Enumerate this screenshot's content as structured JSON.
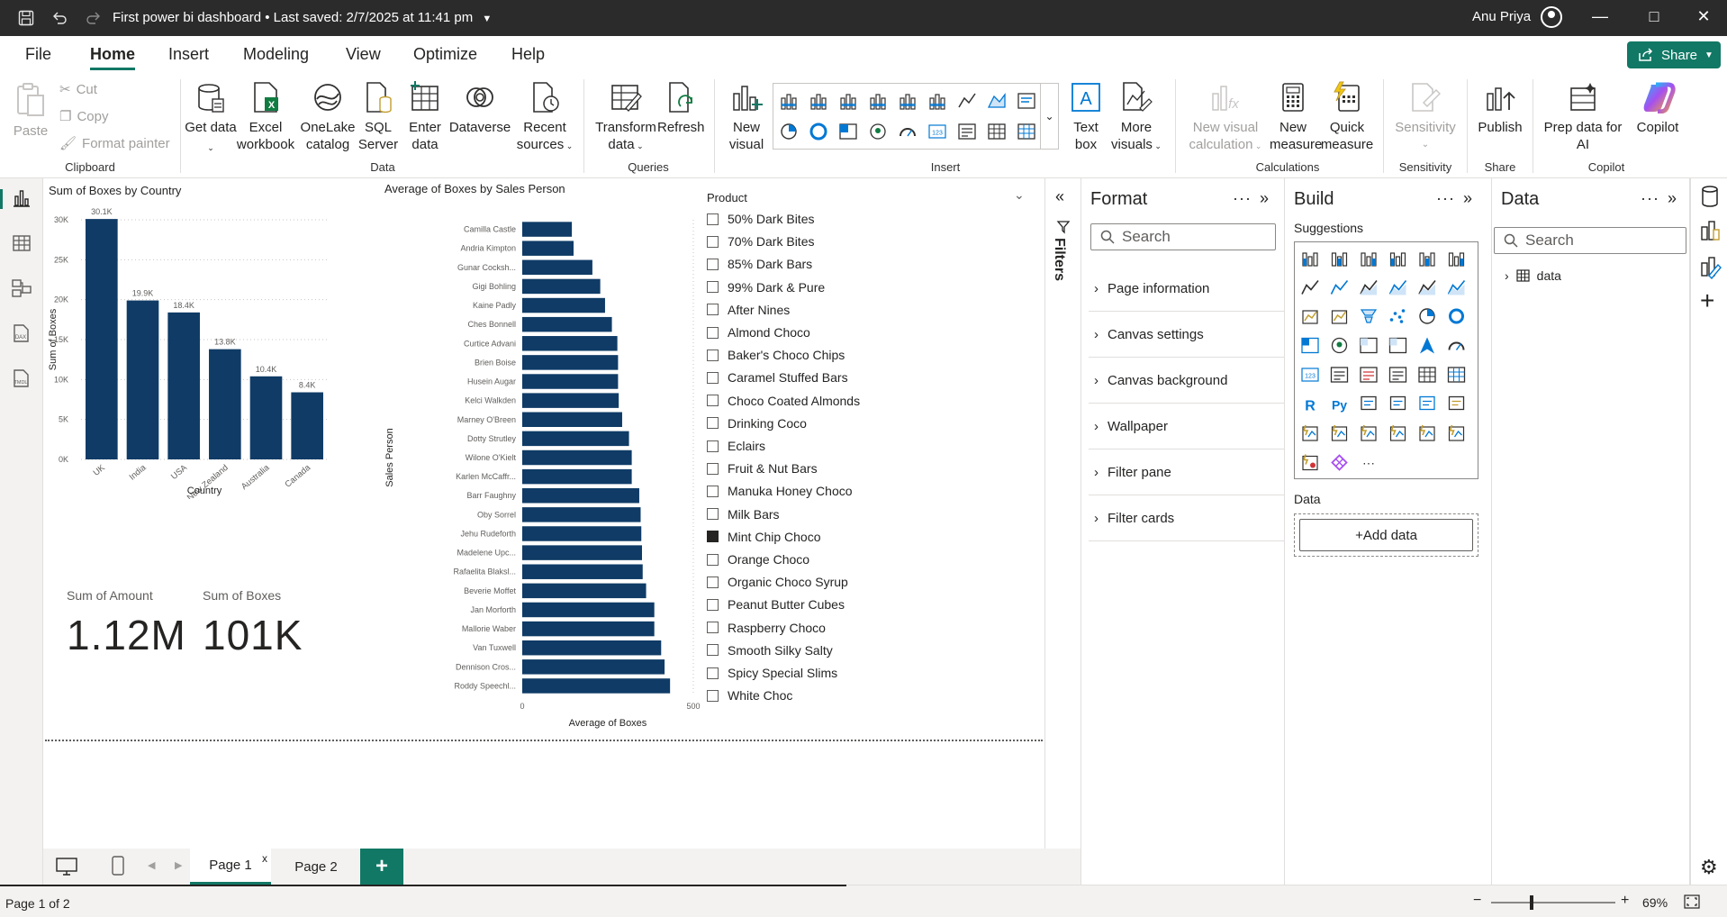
{
  "titlebar": {
    "title": "First power bi dashboard • Last saved: 2/7/2025 at 11:41 pm",
    "user": "Anu Priya",
    "minimize": "—",
    "maximize": "□",
    "close": "✕"
  },
  "menu": {
    "tabs": [
      "File",
      "Home",
      "Insert",
      "Modeling",
      "View",
      "Optimize",
      "Help"
    ],
    "active": "Home",
    "share": "Share"
  },
  "ribbon": {
    "paste": "Paste",
    "cut": "Cut",
    "copy": "Copy",
    "format_painter": "Format painter",
    "get_data": "Get data",
    "excel_workbook": "Excel workbook",
    "onelake_catalog": "OneLake catalog",
    "sql_server": "SQL Server",
    "enter_data": "Enter data",
    "dataverse": "Dataverse",
    "recent_sources": "Recent sources",
    "transform_data": "Transform data",
    "refresh": "Refresh",
    "new_visual": "New visual",
    "text_box": "Text box",
    "more_visuals": "More visuals",
    "new_visual_calculation": "New visual calculation",
    "new_measure": "New measure",
    "quick_measure": "Quick measure",
    "sensitivity": "Sensitivity",
    "publish": "Publish",
    "prep_data_copilot": "Prep data for AI",
    "copilot": "Copilot",
    "groups": {
      "clipboard": "Clipboard",
      "data": "Data",
      "queries": "Queries",
      "insert": "Insert",
      "calculations": "Calculations",
      "sensitivity": "Sensitivity",
      "share": "Share",
      "copilot": "Copilot"
    }
  },
  "leftnav": [
    "report-view",
    "table-view",
    "model-view",
    "dax-query-view",
    "tmdl-view"
  ],
  "visuals": {
    "bar_country": {
      "title": "Sum of Boxes by Country",
      "xlabel": "Country",
      "ylabel": "Sum of Boxes"
    },
    "hbar_sales": {
      "title": "Average of Boxes by Sales Person",
      "xlabel": "Average of Boxes",
      "ylabel": "Sales Person"
    },
    "card_amount": {
      "label": "Sum of Amount",
      "value": "1.12M"
    },
    "card_boxes": {
      "label": "Sum of Boxes",
      "value": "101K"
    }
  },
  "chart_data": [
    {
      "type": "bar",
      "title": "Sum of Boxes by Country",
      "xlabel": "Country",
      "ylabel": "Sum of Boxes",
      "categories": [
        "UK",
        "India",
        "USA",
        "New Zealand",
        "Australia",
        "Canada"
      ],
      "values": [
        30100,
        19900,
        18400,
        13800,
        10400,
        8400
      ],
      "data_labels": [
        "30.1K",
        "19.9K",
        "18.4K",
        "13.8K",
        "10.4K",
        "8.4K"
      ],
      "yticks": [
        0,
        5000,
        10000,
        15000,
        20000,
        25000,
        30000
      ],
      "ytick_labels": [
        "0K",
        "5K",
        "10K",
        "15K",
        "20K",
        "25K",
        "30K"
      ],
      "ylim": [
        0,
        30000
      ],
      "color": "#0f3b66",
      "grid": true
    },
    {
      "type": "bar",
      "orientation": "horizontal",
      "title": "Average of Boxes by Sales Person",
      "xlabel": "Average of Boxes",
      "ylabel": "Sales Person",
      "categories": [
        "Camilla Castle",
        "Andria Kimpton",
        "Gunar Cocksh...",
        "Gigi Bohling",
        "Kaine Padly",
        "Ches Bonnell",
        "Curtice Advani",
        "Brien Boise",
        "Husein Augar",
        "Kelci Walkden",
        "Marney O'Breen",
        "Dotty Strutley",
        "Wilone O'Kielt",
        "Karlen McCaffr...",
        "Barr Faughny",
        "Oby Sorrel",
        "Jehu Rudeforth",
        "Madelene Upc...",
        "Rafaelita Blaksl...",
        "Beverie Moffet",
        "Jan Morforth",
        "Mallorie Waber",
        "Van Tuxwell",
        "Dennison Cros...",
        "Roddy Speechl..."
      ],
      "values": [
        145,
        150,
        205,
        228,
        242,
        262,
        278,
        280,
        280,
        282,
        292,
        312,
        320,
        320,
        342,
        346,
        348,
        350,
        352,
        362,
        386,
        386,
        406,
        416,
        432
      ],
      "xticks": [
        0,
        500
      ],
      "xlim": [
        0,
        500
      ],
      "color": "#0f3b66"
    }
  ],
  "slicer": {
    "title": "Product",
    "items": [
      {
        "label": "50% Dark Bites",
        "checked": false
      },
      {
        "label": "70% Dark Bites",
        "checked": false
      },
      {
        "label": "85% Dark Bars",
        "checked": false
      },
      {
        "label": "99% Dark & Pure",
        "checked": false
      },
      {
        "label": "After Nines",
        "checked": false
      },
      {
        "label": "Almond Choco",
        "checked": false
      },
      {
        "label": "Baker's Choco Chips",
        "checked": false
      },
      {
        "label": "Caramel Stuffed Bars",
        "checked": false
      },
      {
        "label": "Choco Coated Almonds",
        "checked": false
      },
      {
        "label": "Drinking Coco",
        "checked": false
      },
      {
        "label": "Eclairs",
        "checked": false
      },
      {
        "label": "Fruit & Nut Bars",
        "checked": false
      },
      {
        "label": "Manuka Honey Choco",
        "checked": false
      },
      {
        "label": "Milk Bars",
        "checked": false
      },
      {
        "label": "Mint Chip Choco",
        "checked": true
      },
      {
        "label": "Orange Choco",
        "checked": false
      },
      {
        "label": "Organic Choco Syrup",
        "checked": false
      },
      {
        "label": "Peanut Butter Cubes",
        "checked": false
      },
      {
        "label": "Raspberry Choco",
        "checked": false
      },
      {
        "label": "Smooth Silky Salty",
        "checked": false
      },
      {
        "label": "Spicy Special Slims",
        "checked": false
      },
      {
        "label": "White Choc",
        "checked": false
      }
    ]
  },
  "filters": {
    "label": "Filters"
  },
  "format_pane": {
    "title": "Format",
    "search_placeholder": "Search",
    "sections": [
      "Page information",
      "Canvas settings",
      "Canvas background",
      "Wallpaper",
      "Filter pane",
      "Filter cards"
    ]
  },
  "build_pane": {
    "title": "Build",
    "suggestions": "Suggestions",
    "data_label": "Data",
    "add_data": "+Add data",
    "more": "···"
  },
  "data_pane": {
    "title": "Data",
    "search_placeholder": "Search",
    "tables": [
      "data"
    ]
  },
  "pages": {
    "tabs": [
      "Page 1",
      "Page 2"
    ],
    "active": "Page 1",
    "close": "x",
    "add": "+"
  },
  "status": {
    "page_info": "Page 1 of 2",
    "zoom": "69%",
    "zoom_minus": "−",
    "zoom_plus": "+",
    "zoom_level": 0.69
  }
}
